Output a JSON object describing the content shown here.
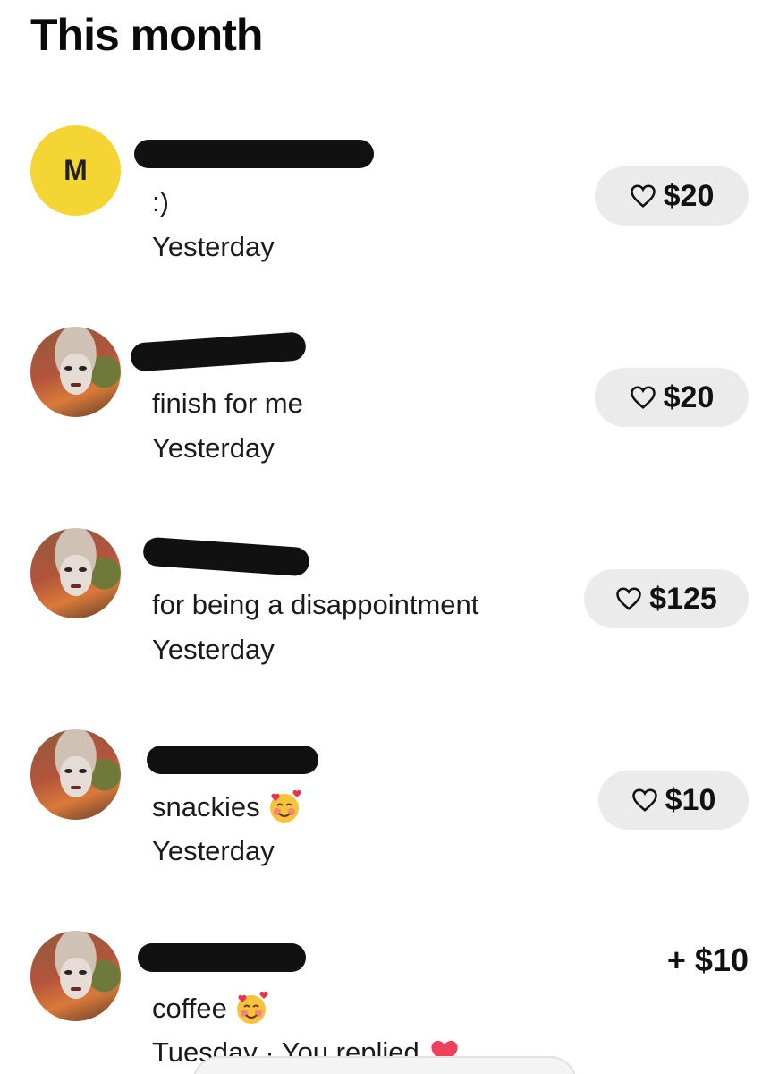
{
  "header": {
    "title": "This month"
  },
  "tips": [
    {
      "avatar_letter": "M",
      "avatar_type": "letter",
      "avatar_color": "#f5d533",
      "message": ":)",
      "time": "Yesterday",
      "amount": "$20",
      "action_icon": "heart-outline-icon"
    },
    {
      "avatar_type": "photo",
      "message": "finish for me",
      "time": "Yesterday",
      "amount": "$20",
      "action_icon": "heart-outline-icon"
    },
    {
      "avatar_type": "photo",
      "message": "for being a disappointment",
      "time": "Yesterday",
      "amount": "$125",
      "action_icon": "heart-outline-icon"
    },
    {
      "avatar_type": "photo",
      "message": "snackies",
      "message_emoji": "smiling-face-with-hearts",
      "time": "Yesterday",
      "amount": "$10",
      "action_icon": "heart-outline-icon"
    },
    {
      "avatar_type": "photo",
      "message": "coffee",
      "message_emoji": "smiling-face-with-hearts",
      "time": "Tuesday · You replied",
      "time_emoji": "red-heart",
      "amount": "+ $10"
    }
  ],
  "colors": {
    "pill_background": "#ebebeb",
    "text": "#111111",
    "avatar_yellow": "#f5d533",
    "heart_red": "#f0405a"
  }
}
